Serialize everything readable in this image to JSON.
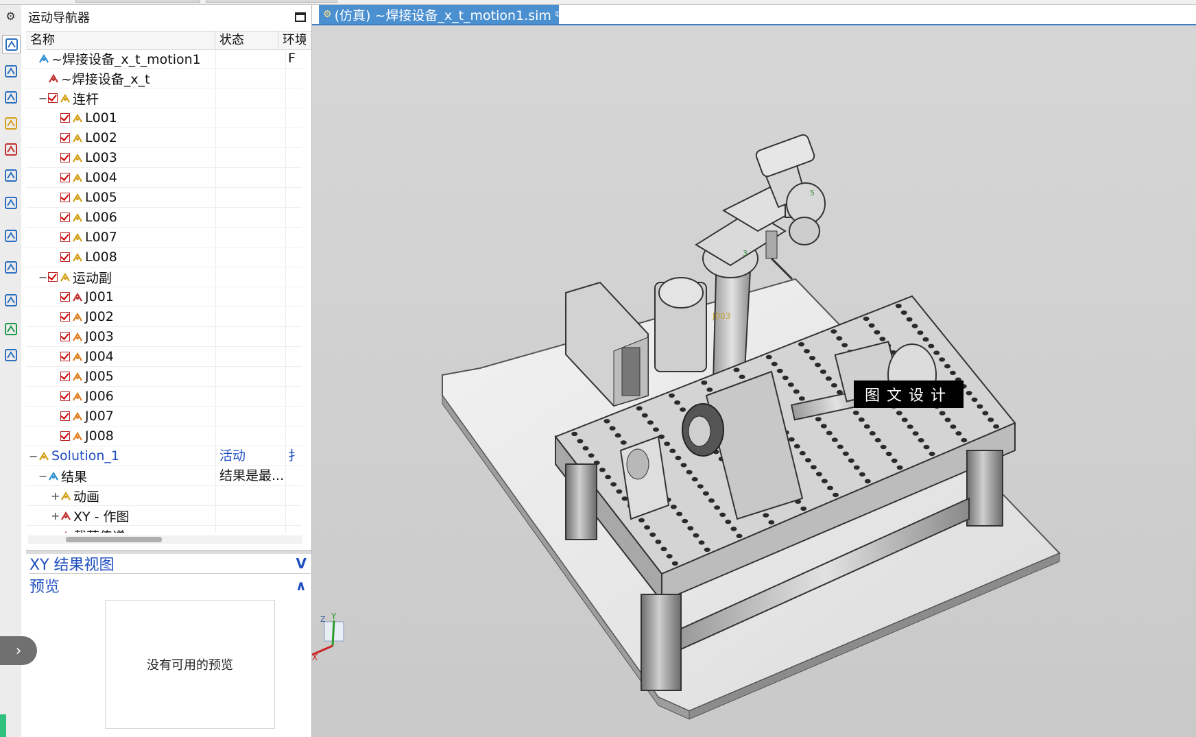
{
  "top_strip": {},
  "rail": {
    "icons": [
      "gear-icon",
      "part-navigator-icon",
      "assembly-navigator-icon",
      "constraint-navigator-icon",
      "part-tree-icon",
      "motion-icon",
      "reuse-library-icon",
      "roles-icon",
      "info-icon",
      "documents-icon",
      "history-icon",
      "palette-icon",
      "process-icon"
    ],
    "expand_glyph": "›"
  },
  "navigator": {
    "title": "运动导航器",
    "columns": [
      "名称",
      "状态",
      "环境"
    ],
    "rows": [
      {
        "label": "~焊接设备_x_t_motion1",
        "status": "",
        "env": "F",
        "level": 0,
        "toggle": "",
        "checkbox": false,
        "icon": "sim-icon"
      },
      {
        "label": "~焊接设备_x_t",
        "status": "",
        "env": "",
        "level": 1,
        "toggle": "",
        "checkbox": false,
        "icon": "assembly-icon"
      },
      {
        "label": "连杆",
        "status": "",
        "env": "",
        "level": 1,
        "toggle": "−",
        "checkbox": true,
        "icon": "link-folder-icon"
      },
      {
        "label": "L001",
        "status": "",
        "env": "",
        "level": 2,
        "toggle": "",
        "checkbox": true,
        "icon": "link-fixed-icon"
      },
      {
        "label": "L002",
        "status": "",
        "env": "",
        "level": 2,
        "toggle": "",
        "checkbox": true,
        "icon": "link-icon"
      },
      {
        "label": "L003",
        "status": "",
        "env": "",
        "level": 2,
        "toggle": "",
        "checkbox": true,
        "icon": "link-icon"
      },
      {
        "label": "L004",
        "status": "",
        "env": "",
        "level": 2,
        "toggle": "",
        "checkbox": true,
        "icon": "link-icon"
      },
      {
        "label": "L005",
        "status": "",
        "env": "",
        "level": 2,
        "toggle": "",
        "checkbox": true,
        "icon": "link-icon"
      },
      {
        "label": "L006",
        "status": "",
        "env": "",
        "level": 2,
        "toggle": "",
        "checkbox": true,
        "icon": "link-icon"
      },
      {
        "label": "L007",
        "status": "",
        "env": "",
        "level": 2,
        "toggle": "",
        "checkbox": true,
        "icon": "link-icon"
      },
      {
        "label": "L008",
        "status": "",
        "env": "",
        "level": 2,
        "toggle": "",
        "checkbox": true,
        "icon": "link-icon"
      },
      {
        "label": "运动副",
        "status": "",
        "env": "",
        "level": 1,
        "toggle": "−",
        "checkbox": true,
        "icon": "joint-folder-icon"
      },
      {
        "label": "J001",
        "status": "",
        "env": "",
        "level": 2,
        "toggle": "",
        "checkbox": true,
        "icon": "joint-fixed-icon"
      },
      {
        "label": "J002",
        "status": "",
        "env": "",
        "level": 2,
        "toggle": "",
        "checkbox": true,
        "icon": "joint-revolute-icon"
      },
      {
        "label": "J003",
        "status": "",
        "env": "",
        "level": 2,
        "toggle": "",
        "checkbox": true,
        "icon": "joint-revolute-icon"
      },
      {
        "label": "J004",
        "status": "",
        "env": "",
        "level": 2,
        "toggle": "",
        "checkbox": true,
        "icon": "joint-revolute-icon"
      },
      {
        "label": "J005",
        "status": "",
        "env": "",
        "level": 2,
        "toggle": "",
        "checkbox": true,
        "icon": "joint-revolute-icon"
      },
      {
        "label": "J006",
        "status": "",
        "env": "",
        "level": 2,
        "toggle": "",
        "checkbox": true,
        "icon": "joint-revolute-icon"
      },
      {
        "label": "J007",
        "status": "",
        "env": "",
        "level": 2,
        "toggle": "",
        "checkbox": true,
        "icon": "joint-revolute-icon"
      },
      {
        "label": "J008",
        "status": "",
        "env": "",
        "level": 2,
        "toggle": "",
        "checkbox": true,
        "icon": "joint-revolute-icon"
      },
      {
        "label": "Solution_1",
        "status": "活动",
        "env": "扌",
        "level": 0,
        "toggle": "−",
        "checkbox": false,
        "icon": "solution-icon",
        "link": true
      },
      {
        "label": "结果",
        "status": "结果是最...",
        "env": "",
        "level": 1,
        "toggle": "−",
        "checkbox": false,
        "icon": "results-icon"
      },
      {
        "label": "动画",
        "status": "",
        "env": "",
        "level": 2,
        "toggle": "+",
        "checkbox": false,
        "icon": "animation-icon"
      },
      {
        "label": "XY - 作图",
        "status": "",
        "env": "",
        "level": 2,
        "toggle": "+",
        "checkbox": false,
        "icon": "xy-graph-icon"
      },
      {
        "label": "载荷传递",
        "status": "",
        "env": "",
        "level": 2,
        "toggle": "",
        "checkbox": false,
        "icon": "load-transfer-icon"
      }
    ]
  },
  "xy_result_view": {
    "title": "XY 结果视图",
    "chevron": "V"
  },
  "preview": {
    "title": "预览",
    "chevron": "∧",
    "empty_text": "没有可用的预览"
  },
  "viewport": {
    "tab_label": "(仿真) ~焊接设备_x_t_motion1.sim",
    "tab_pin": "⧉",
    "tab_close": "×",
    "watermark": "图文设计",
    "triad": {
      "x": "X",
      "y": "Y",
      "z": "Z"
    },
    "joint_labels": [
      "J003",
      "5",
      "3"
    ]
  },
  "colors": {
    "accent": "#4a8fd0",
    "link": "#1f4fbf",
    "check": "#cc0000",
    "viewport_bg": "#d3d3d3"
  }
}
